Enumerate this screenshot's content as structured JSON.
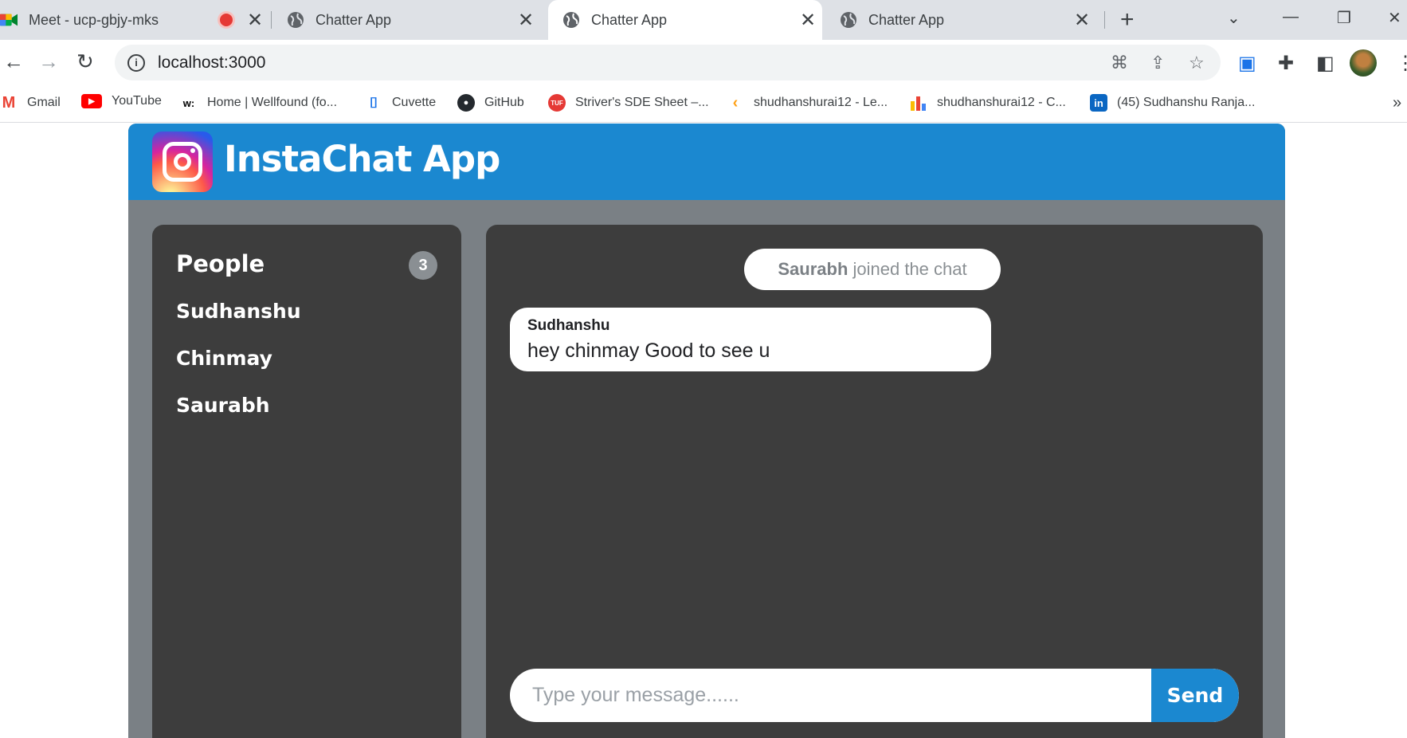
{
  "browser": {
    "tabs": [
      {
        "title": "Meet - ucp-gbjy-mks",
        "icon": "google-meet-icon",
        "recording": true
      },
      {
        "title": "Chatter App",
        "icon": "globe-icon"
      },
      {
        "title": "Chatter App",
        "icon": "globe-icon",
        "active": true
      },
      {
        "title": "Chatter App",
        "icon": "globe-icon"
      }
    ],
    "url": "localhost:3000",
    "bookmarks": [
      {
        "label": "Gmail"
      },
      {
        "label": "YouTube"
      },
      {
        "label": "Home | Wellfound (fo..."
      },
      {
        "label": "Cuvette"
      },
      {
        "label": "GitHub"
      },
      {
        "label": "Striver's SDE Sheet –..."
      },
      {
        "label": "shudhanshurai12 - Le..."
      },
      {
        "label": "shudhanshurai12 - C..."
      },
      {
        "label": "(45) Sudhanshu Ranja..."
      }
    ]
  },
  "app": {
    "title": "InstaChat App",
    "people": {
      "heading": "People",
      "count": "3",
      "list": [
        "Sudhanshu",
        "Chinmay",
        "Saurabh"
      ]
    },
    "chat": {
      "system_message": {
        "name": "Saurabh",
        "text": " joined the chat"
      },
      "messages": [
        {
          "author": "Sudhanshu",
          "text": "hey chinmay Good to see u"
        }
      ],
      "input_placeholder": "Type your message......",
      "send_label": "Send"
    },
    "colors": {
      "header": "#1b88d0",
      "panel": "#3d3d3d",
      "background": "#7a8085"
    }
  }
}
